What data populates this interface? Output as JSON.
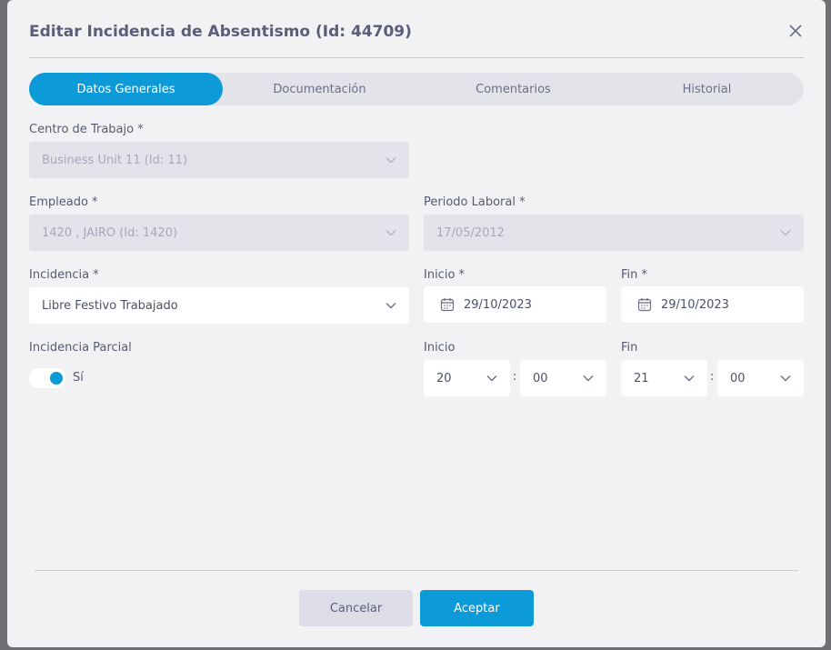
{
  "modal": {
    "title": "Editar Incidencia de Absentismo (Id: 44709)"
  },
  "tabs": [
    {
      "label": "Datos Generales",
      "active": true
    },
    {
      "label": "Documentación",
      "active": false
    },
    {
      "label": "Comentarios",
      "active": false
    },
    {
      "label": "Historial",
      "active": false
    }
  ],
  "form": {
    "centro": {
      "label": "Centro de Trabajo *",
      "value": "Business Unit 11 (Id: 11)"
    },
    "empleado": {
      "label": "Empleado *",
      "value": "1420 , JAIRO (Id: 1420)"
    },
    "periodo": {
      "label": "Periodo Laboral *",
      "value": "17/05/2012"
    },
    "incidencia": {
      "label": "Incidencia *",
      "value": "Libre Festivo Trabajado"
    },
    "inicio_fecha": {
      "label": "Inicio *",
      "value": "29/10/2023"
    },
    "fin_fecha": {
      "label": "Fin *",
      "value": "29/10/2023"
    },
    "parcial": {
      "label": "Incidencia Parcial",
      "toggle_label": "Sí",
      "checked": true
    },
    "inicio_hora": {
      "label": "Inicio",
      "hour": "20",
      "minute": "00",
      "separator": ":"
    },
    "fin_hora": {
      "label": "Fin",
      "hour": "21",
      "minute": "00",
      "separator": ":"
    }
  },
  "footer": {
    "cancel_label": "Cancelar",
    "accept_label": "Aceptar"
  },
  "colors": {
    "accent": "#0d9ad8",
    "title": "#5a5e78"
  },
  "icons": {
    "close": "close-icon",
    "chevron": "chevron-down-icon",
    "calendar": "calendar-icon"
  }
}
